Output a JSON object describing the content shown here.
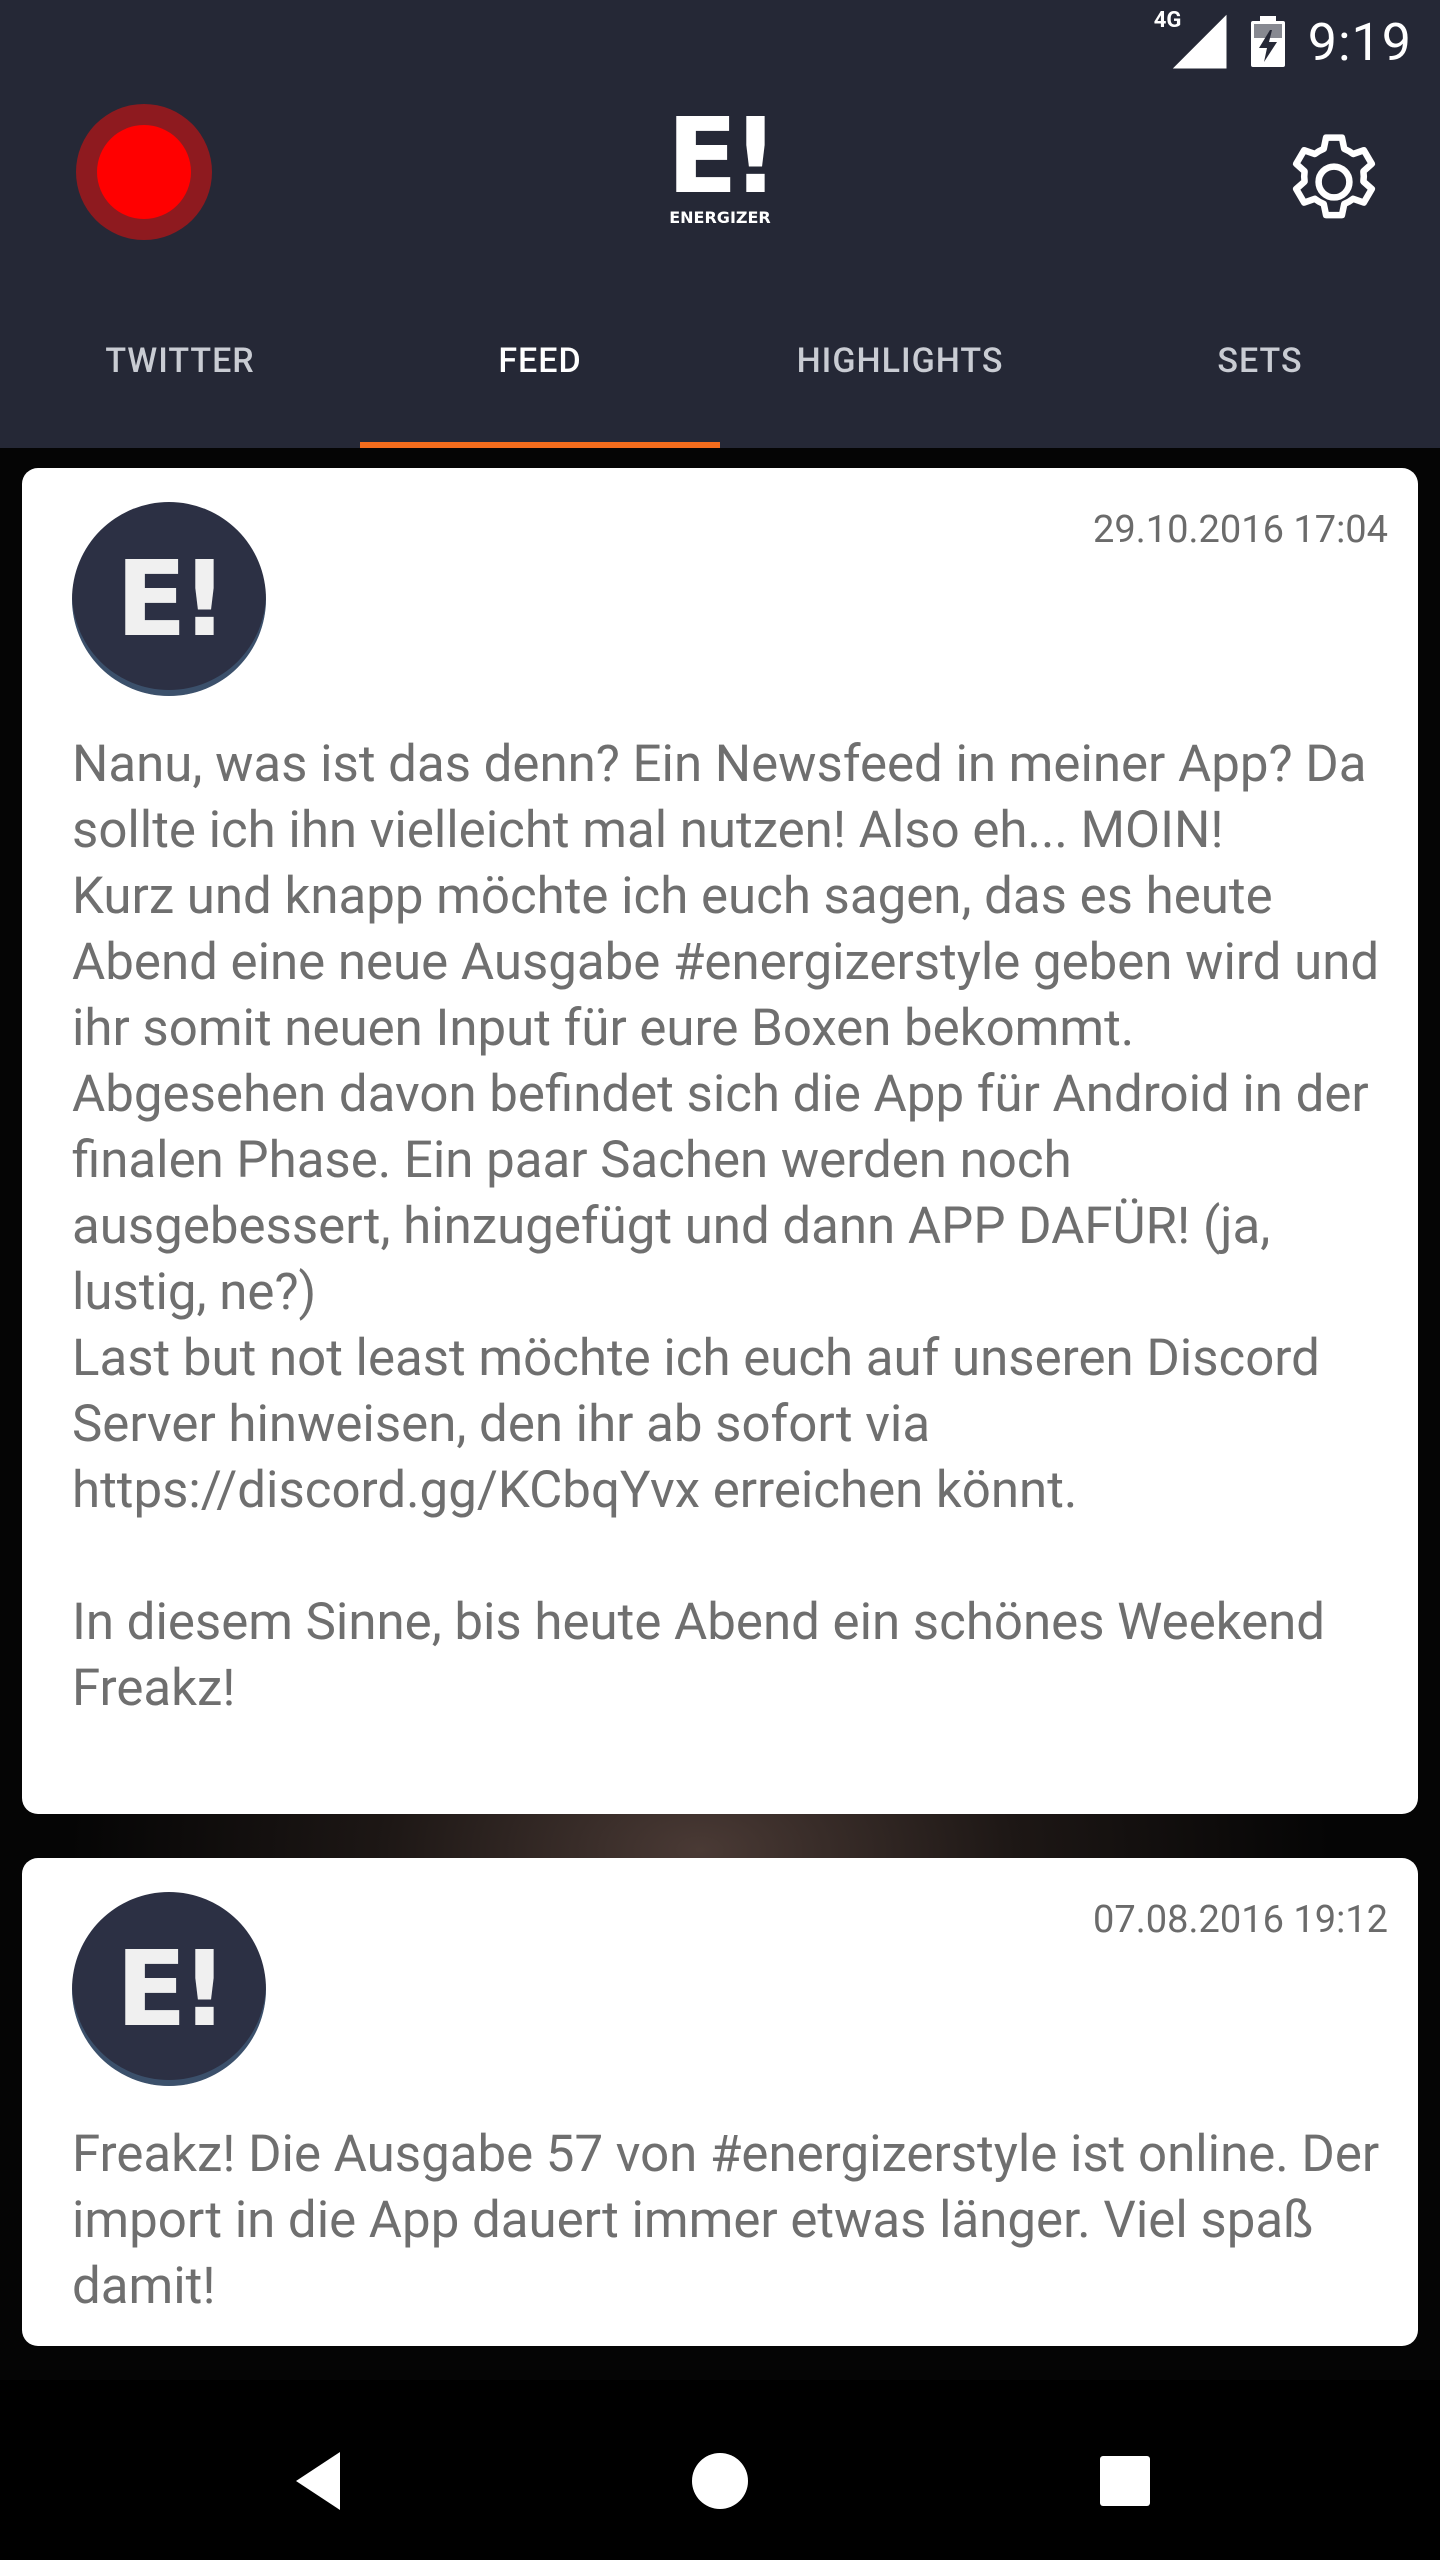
{
  "status_bar": {
    "network": "4G",
    "time": "9:19"
  },
  "header": {
    "logo": {
      "mark": "E!",
      "wordmark": "ENERGIZER"
    }
  },
  "tabs": [
    {
      "label": "TWITTER",
      "active": false
    },
    {
      "label": "FEED",
      "active": true
    },
    {
      "label": "HIGHLIGHTS",
      "active": false
    },
    {
      "label": "SETS",
      "active": false
    }
  ],
  "colors": {
    "header_bg": "#252836",
    "accent": "#f36c1d",
    "record_red": "#ff0000"
  },
  "feed": [
    {
      "avatar_mark": "E!",
      "date": "29.10.2016 17:04",
      "text": "Nanu, was ist das denn? Ein Newsfeed in meiner App? Da sollte ich ihn vielleicht mal nutzen! Also eh... MOIN!\nKurz und knapp möchte ich euch sagen, das es heute Abend eine neue Ausgabe #energizerstyle geben wird und ihr somit neuen Input für eure Boxen bekommt.\nAbgesehen davon befindet sich die App für Android in der finalen Phase. Ein paar Sachen werden noch ausgebessert, hinzugefügt und dann APP DAFÜR! (ja, lustig, ne?)\nLast but not least möchte ich euch auf unseren Discord Server hinweisen, den ihr ab sofort via https://discord.gg/KCbqYvx erreichen könnt.\n\nIn diesem Sinne, bis heute Abend ein schönes Weekend Freakz!"
    },
    {
      "avatar_mark": "E!",
      "date": "07.08.2016 19:12",
      "text": "Freakz! Die Ausgabe 57 von #energizerstyle ist online. Der import in die App dauert immer etwas länger. Viel spaß damit!"
    }
  ]
}
